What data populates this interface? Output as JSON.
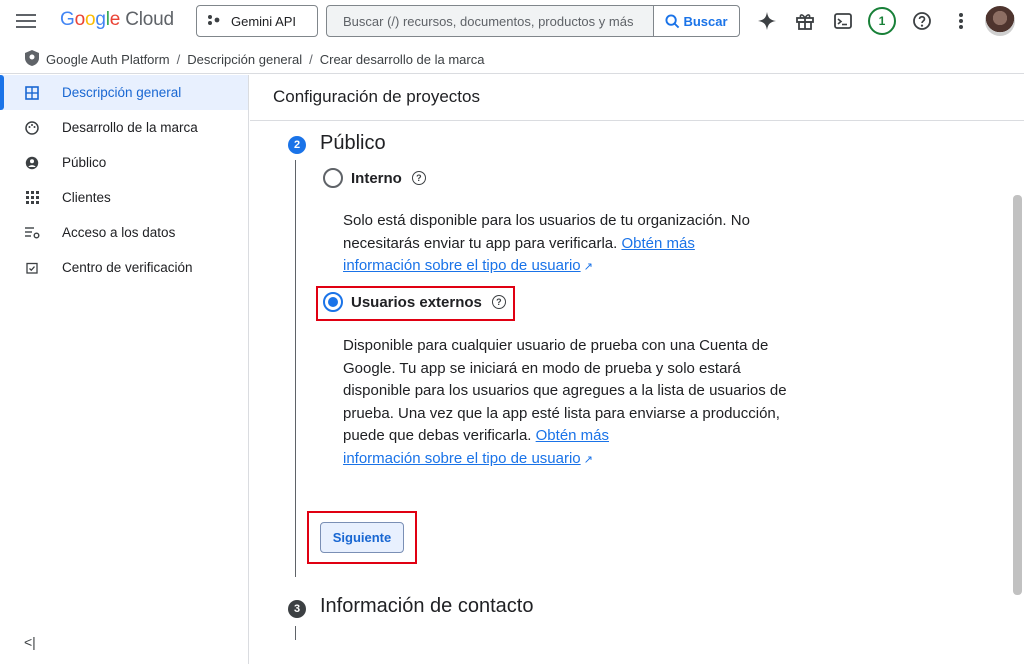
{
  "header": {
    "logo": {
      "google": "Google",
      "cloud": "Cloud"
    },
    "project_label": "Gemini API",
    "search_placeholder": "Buscar (/) recursos, documentos, productos y más",
    "search_button": "Buscar",
    "notification_count": "1",
    "icons": [
      "menu-icon",
      "sparkle-icon",
      "gift-icon",
      "terminal-icon",
      "help-icon",
      "more-vert-icon"
    ]
  },
  "breadcrumb": {
    "items": [
      "Google Auth Platform",
      "Descripción general",
      "Crear desarrollo de la marca"
    ],
    "separator": "/"
  },
  "sidebar": {
    "items": [
      {
        "label": "Descripción general",
        "icon": "dashboard-icon",
        "active": true
      },
      {
        "label": "Desarrollo de la marca",
        "icon": "palette-icon"
      },
      {
        "label": "Público",
        "icon": "person-icon"
      },
      {
        "label": "Clientes",
        "icon": "apps-grid-icon"
      },
      {
        "label": "Acceso a los datos",
        "icon": "data-access-icon"
      },
      {
        "label": "Centro de verificación",
        "icon": "verification-icon"
      }
    ],
    "collapse_label": "<|"
  },
  "main": {
    "title": "Configuración de proyectos",
    "step2": {
      "number": "2",
      "title": "Público",
      "internal": {
        "label": "Interno",
        "selected": false,
        "desc_text": "Solo está disponible para los usuarios de tu organización. No necesitarás enviar tu app para verificarla. ",
        "link1": "Obtén más",
        "link2": "información sobre el tipo de usuario"
      },
      "external": {
        "label": "Usuarios externos",
        "selected": true,
        "desc_text": "Disponible para cualquier usuario de prueba con una Cuenta de Google. Tu app se iniciará en modo de prueba y solo estará disponible para los usuarios que agregues a la lista de usuarios de prueba. Una vez que la app esté lista para enviarse a producción, puede que debas verificarla. ",
        "link1": "Obtén más",
        "link2": "información sobre el tipo de usuario"
      },
      "next_button": "Siguiente"
    },
    "step3": {
      "number": "3",
      "title": "Información de contacto"
    }
  },
  "colors": {
    "accent": "#1a73e8",
    "highlight": "#e00012",
    "active_bg": "#e8f0fe"
  }
}
